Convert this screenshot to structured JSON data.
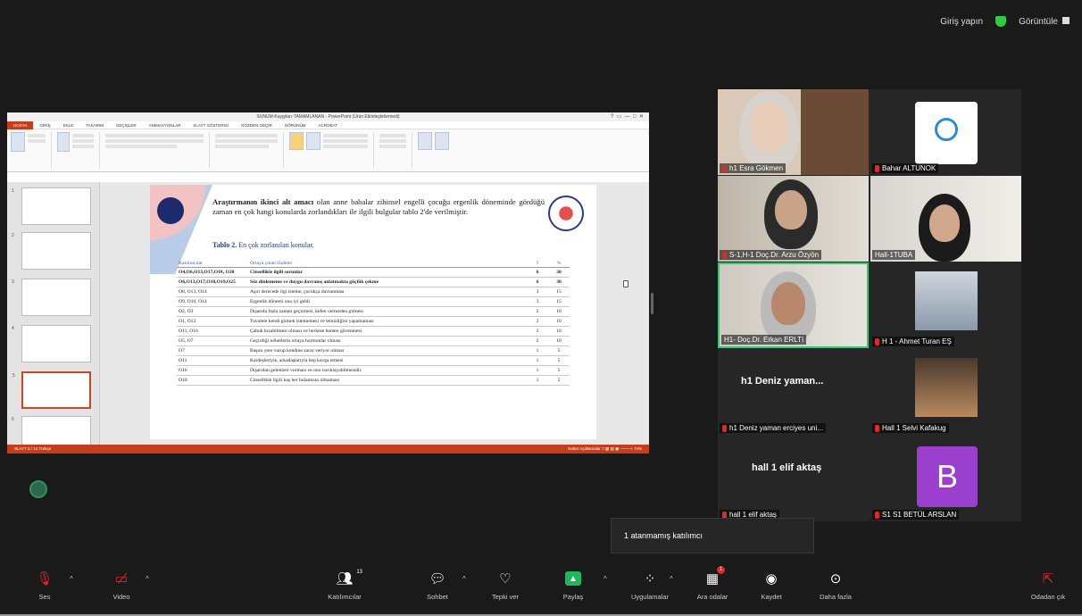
{
  "topbar": {
    "signin": "Giriş yapın",
    "view": "Görüntüle"
  },
  "ppt": {
    "window_title": "SUNUM-Kaygıları-TAMAMLANAN - PowerPoint (Ürün Etkinleştirilemedi)",
    "tabs": [
      "DOSYA",
      "GİRİŞ",
      "EKLE",
      "TASARIM",
      "GEÇİŞLER",
      "ANİMASYONLAR",
      "SLAYT GÖSTERİSİ",
      "GÖZDEN GEÇİR",
      "GÖRÜNÜM",
      "ACROBAT"
    ],
    "status_left": "SLAYT 5 / 10   Türkçe",
    "status_right": "Notlar   Açıklamalar   □ ▦ ▤ ▣  −——+  74%",
    "paragraph_bold": "Araştırmanın ikinci alt amacı",
    "paragraph_rest": "olan anne babalar zihinsel engelli çocuğu ergenlik döneminde gördüğü zaman en çok hangi konularda zorlandıkları ile ilgili bulgular tablo 2'de verilmiştir.",
    "table_caption_bold": "Tablo 2.",
    "table_caption_rest": " En çok zorlanılan konular.",
    "table_headers": [
      "Katılımcılar",
      "Ortaya çıkan ifadeler",
      "f",
      "%"
    ],
    "table_rows": [
      {
        "a": "O4,O6,O13,O17,O18, O20",
        "b": "Cinsellikle ilgili sorunlar",
        "f": "6",
        "p": "30",
        "bold": true
      },
      {
        "a": "O6,O13,O17,O18,O19,O25",
        "b": "Söz dinlememe ve duygu davranış anlatmakta güçlük çekme",
        "f": "6",
        "p": "30",
        "bold": true
      },
      {
        "a": "O8, O13, O14",
        "b": "Aşırı derecede ilgi isteme, çocukça davranması",
        "f": "3",
        "p": "15",
        "bold": false
      },
      {
        "a": "O9, O10, O14",
        "b": "Ergenlik dönemi onu iyi geldi",
        "f": "3",
        "p": "15",
        "bold": false
      },
      {
        "a": "O2, O3",
        "b": "Dışarıda fazla zaman geçirmesi, kefen vermeden gitmesi",
        "f": "2",
        "p": "10",
        "bold": false
      },
      {
        "a": "O1, O12",
        "b": "Tuvalete kendi girmek istememesi ve temizliğini yapamaması",
        "f": "2",
        "p": "10",
        "bold": false
      },
      {
        "a": "O11, O16",
        "b": "Çabuk kızabilmesi olması ve herkese hemen güvenmesi",
        "f": "2",
        "p": "10",
        "bold": false
      },
      {
        "a": "O5, O7",
        "b": "Geçirdiği nöbetlerin ortaya hormonlar olması",
        "f": "2",
        "p": "10",
        "bold": false
      },
      {
        "a": "O7",
        "b": "Başını yere vurup kendine zarar veriyor olması",
        "f": "1",
        "p": "5",
        "bold": false
      },
      {
        "a": "O11",
        "b": "Kardeşleriyle, arkadaşlarıyla hep kavga etmesi",
        "f": "1",
        "p": "5",
        "bold": false
      },
      {
        "a": "O16",
        "b": "Dışarıdan gelenlere vurması ve onu ısırıklayabilmesidir.",
        "f": "1",
        "p": "5",
        "bold": false
      },
      {
        "a": "O18",
        "b": "Cinsellikle ilgili kaş her bulantısın olmaması",
        "f": "1",
        "p": "5",
        "bold": false
      }
    ]
  },
  "participants": [
    {
      "name": "h1 Esra Gökmen",
      "muted": true
    },
    {
      "name": "Bahar ALTUNOK",
      "muted": true
    },
    {
      "name": "S-1,H-1 Doç.Dr. Arzu Özyön",
      "muted": true
    },
    {
      "name": "Hall-1TUBA",
      "muted": false
    },
    {
      "name": "H1- Doç.Dr. Erkan ERLTI",
      "muted": false
    },
    {
      "name": "H 1 - Ahmet Turan EŞ",
      "muted": true
    },
    {
      "name": "h1 Deniz yaman erciyes uni...",
      "muted": true,
      "display": "h1  Deniz yaman..."
    },
    {
      "name": "Hall 1 Selvi Kafakug",
      "muted": true
    },
    {
      "name": "hall 1 elif aktaş",
      "muted": true,
      "display": "hall 1 elif aktaş"
    },
    {
      "name": "S1 S1 BETÜL ARSLAN",
      "muted": true,
      "avatar": "B"
    }
  ],
  "tooltip": "1 atanmamış katılımcı",
  "toolbar": {
    "mute": "Ses",
    "video": "Video",
    "participants": "Katılımcılar",
    "participants_count": "13",
    "chat": "Sohbet",
    "react": "Tepki ver",
    "share": "Paylaş",
    "apps": "Uygulamalar",
    "rooms": "Ara odalar",
    "rooms_badge": "1",
    "record": "Kaydet",
    "more": "Daha fazla",
    "leave": "Odadan çık"
  }
}
